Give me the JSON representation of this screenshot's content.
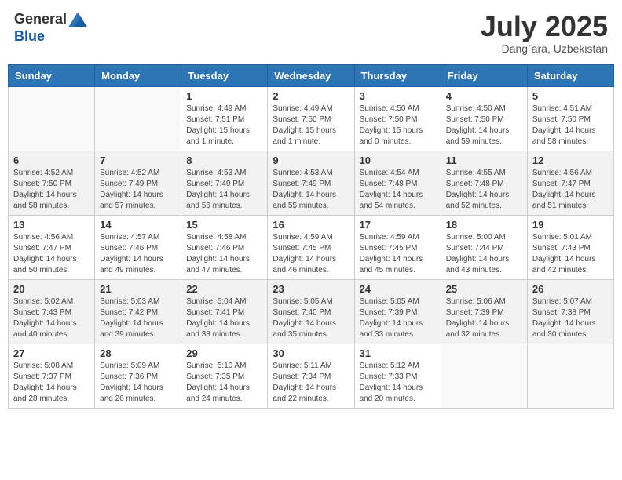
{
  "header": {
    "logo_line1": "General",
    "logo_line2": "Blue",
    "month_title": "July 2025",
    "location": "Dang`ara, Uzbekistan"
  },
  "days_of_week": [
    "Sunday",
    "Monday",
    "Tuesday",
    "Wednesday",
    "Thursday",
    "Friday",
    "Saturday"
  ],
  "weeks": [
    [
      {
        "day": "",
        "info": ""
      },
      {
        "day": "",
        "info": ""
      },
      {
        "day": "1",
        "info": "Sunrise: 4:49 AM\nSunset: 7:51 PM\nDaylight: 15 hours\nand 1 minute."
      },
      {
        "day": "2",
        "info": "Sunrise: 4:49 AM\nSunset: 7:50 PM\nDaylight: 15 hours\nand 1 minute."
      },
      {
        "day": "3",
        "info": "Sunrise: 4:50 AM\nSunset: 7:50 PM\nDaylight: 15 hours\nand 0 minutes."
      },
      {
        "day": "4",
        "info": "Sunrise: 4:50 AM\nSunset: 7:50 PM\nDaylight: 14 hours\nand 59 minutes."
      },
      {
        "day": "5",
        "info": "Sunrise: 4:51 AM\nSunset: 7:50 PM\nDaylight: 14 hours\nand 58 minutes."
      }
    ],
    [
      {
        "day": "6",
        "info": "Sunrise: 4:52 AM\nSunset: 7:50 PM\nDaylight: 14 hours\nand 58 minutes."
      },
      {
        "day": "7",
        "info": "Sunrise: 4:52 AM\nSunset: 7:49 PM\nDaylight: 14 hours\nand 57 minutes."
      },
      {
        "day": "8",
        "info": "Sunrise: 4:53 AM\nSunset: 7:49 PM\nDaylight: 14 hours\nand 56 minutes."
      },
      {
        "day": "9",
        "info": "Sunrise: 4:53 AM\nSunset: 7:49 PM\nDaylight: 14 hours\nand 55 minutes."
      },
      {
        "day": "10",
        "info": "Sunrise: 4:54 AM\nSunset: 7:48 PM\nDaylight: 14 hours\nand 54 minutes."
      },
      {
        "day": "11",
        "info": "Sunrise: 4:55 AM\nSunset: 7:48 PM\nDaylight: 14 hours\nand 52 minutes."
      },
      {
        "day": "12",
        "info": "Sunrise: 4:56 AM\nSunset: 7:47 PM\nDaylight: 14 hours\nand 51 minutes."
      }
    ],
    [
      {
        "day": "13",
        "info": "Sunrise: 4:56 AM\nSunset: 7:47 PM\nDaylight: 14 hours\nand 50 minutes."
      },
      {
        "day": "14",
        "info": "Sunrise: 4:57 AM\nSunset: 7:46 PM\nDaylight: 14 hours\nand 49 minutes."
      },
      {
        "day": "15",
        "info": "Sunrise: 4:58 AM\nSunset: 7:46 PM\nDaylight: 14 hours\nand 47 minutes."
      },
      {
        "day": "16",
        "info": "Sunrise: 4:59 AM\nSunset: 7:45 PM\nDaylight: 14 hours\nand 46 minutes."
      },
      {
        "day": "17",
        "info": "Sunrise: 4:59 AM\nSunset: 7:45 PM\nDaylight: 14 hours\nand 45 minutes."
      },
      {
        "day": "18",
        "info": "Sunrise: 5:00 AM\nSunset: 7:44 PM\nDaylight: 14 hours\nand 43 minutes."
      },
      {
        "day": "19",
        "info": "Sunrise: 5:01 AM\nSunset: 7:43 PM\nDaylight: 14 hours\nand 42 minutes."
      }
    ],
    [
      {
        "day": "20",
        "info": "Sunrise: 5:02 AM\nSunset: 7:43 PM\nDaylight: 14 hours\nand 40 minutes."
      },
      {
        "day": "21",
        "info": "Sunrise: 5:03 AM\nSunset: 7:42 PM\nDaylight: 14 hours\nand 39 minutes."
      },
      {
        "day": "22",
        "info": "Sunrise: 5:04 AM\nSunset: 7:41 PM\nDaylight: 14 hours\nand 38 minutes."
      },
      {
        "day": "23",
        "info": "Sunrise: 5:05 AM\nSunset: 7:40 PM\nDaylight: 14 hours\nand 35 minutes."
      },
      {
        "day": "24",
        "info": "Sunrise: 5:05 AM\nSunset: 7:39 PM\nDaylight: 14 hours\nand 33 minutes."
      },
      {
        "day": "25",
        "info": "Sunrise: 5:06 AM\nSunset: 7:39 PM\nDaylight: 14 hours\nand 32 minutes."
      },
      {
        "day": "26",
        "info": "Sunrise: 5:07 AM\nSunset: 7:38 PM\nDaylight: 14 hours\nand 30 minutes."
      }
    ],
    [
      {
        "day": "27",
        "info": "Sunrise: 5:08 AM\nSunset: 7:37 PM\nDaylight: 14 hours\nand 28 minutes."
      },
      {
        "day": "28",
        "info": "Sunrise: 5:09 AM\nSunset: 7:36 PM\nDaylight: 14 hours\nand 26 minutes."
      },
      {
        "day": "29",
        "info": "Sunrise: 5:10 AM\nSunset: 7:35 PM\nDaylight: 14 hours\nand 24 minutes."
      },
      {
        "day": "30",
        "info": "Sunrise: 5:11 AM\nSunset: 7:34 PM\nDaylight: 14 hours\nand 22 minutes."
      },
      {
        "day": "31",
        "info": "Sunrise: 5:12 AM\nSunset: 7:33 PM\nDaylight: 14 hours\nand 20 minutes."
      },
      {
        "day": "",
        "info": ""
      },
      {
        "day": "",
        "info": ""
      }
    ]
  ]
}
